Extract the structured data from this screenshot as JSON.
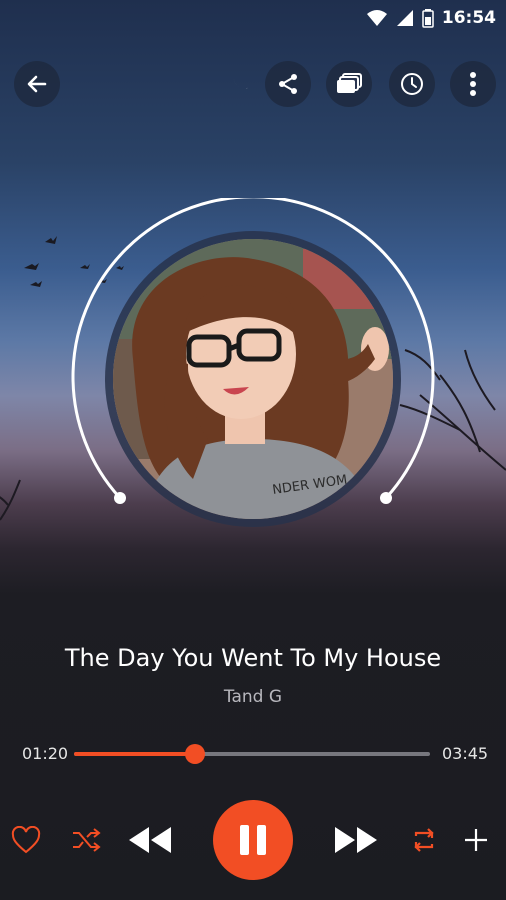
{
  "status_bar": {
    "time": "16:54"
  },
  "track": {
    "title": "The Day You Went To My House",
    "artist": "Tand G"
  },
  "progress": {
    "elapsed": "01:20",
    "duration": "03:45",
    "fraction": 0.34
  },
  "colors": {
    "accent": "#f24e24",
    "title_text": "#ffffff",
    "artist_text": "#b7b7bd"
  },
  "icons": {
    "top_bar": [
      "back-arrow-icon",
      "moon-icon",
      "share-icon",
      "queue-icon",
      "timer-icon",
      "more-vert-icon"
    ],
    "controls": [
      "heart-icon",
      "shuffle-icon",
      "rewind-icon",
      "pause-icon",
      "fast-forward-icon",
      "repeat-icon",
      "plus-icon"
    ]
  }
}
